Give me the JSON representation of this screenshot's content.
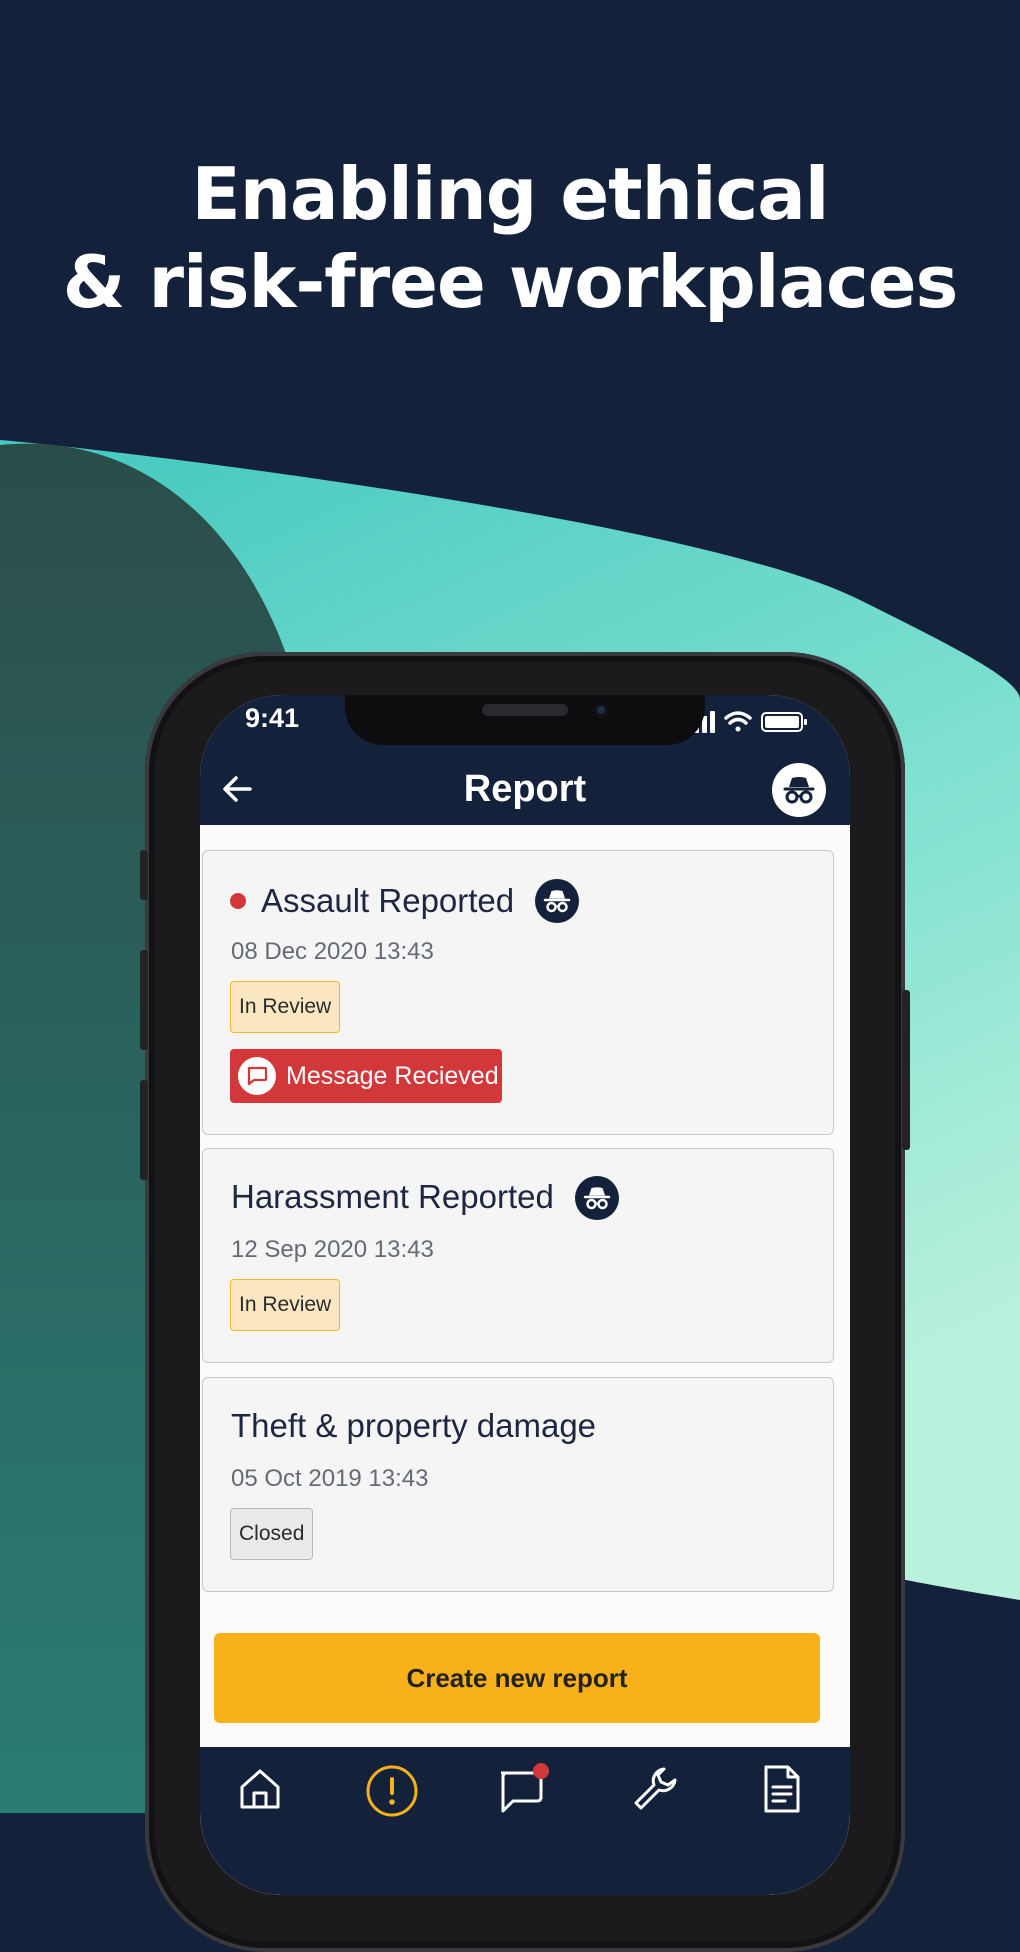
{
  "headline": {
    "line1": "Enabling ethical",
    "line2": "& risk-free workplaces"
  },
  "colors": {
    "navy": "#13223a",
    "teal": "#55d1c6",
    "dark_green": "#2a5a56",
    "accent_yellow": "#f8b119",
    "alert_red": "#d2373a"
  },
  "status_bar": {
    "time": "9:41",
    "icons": [
      "signal-icon",
      "wifi-icon",
      "battery-icon"
    ]
  },
  "app_bar": {
    "title": "Report",
    "back_icon": "back-arrow-icon",
    "anon_icon": "incognito-icon"
  },
  "reports": [
    {
      "title": "Assault Reported",
      "date": "08 Dec 2020  13:43",
      "status": "In Review",
      "unread": true,
      "anonymous": true,
      "message_label": "Message Recieved"
    },
    {
      "title": "Harassment Reported",
      "date": "12 Sep 2020  13:43",
      "status": "In Review",
      "anonymous": true
    },
    {
      "title": "Theft & property damage",
      "date": "05 Oct 2019  13:43",
      "status": "Closed",
      "anonymous": false
    }
  ],
  "create_button": "Create new report",
  "bottom_nav": [
    "home-icon",
    "report-alert-icon",
    "chat-icon",
    "wrench-icon",
    "document-icon"
  ]
}
